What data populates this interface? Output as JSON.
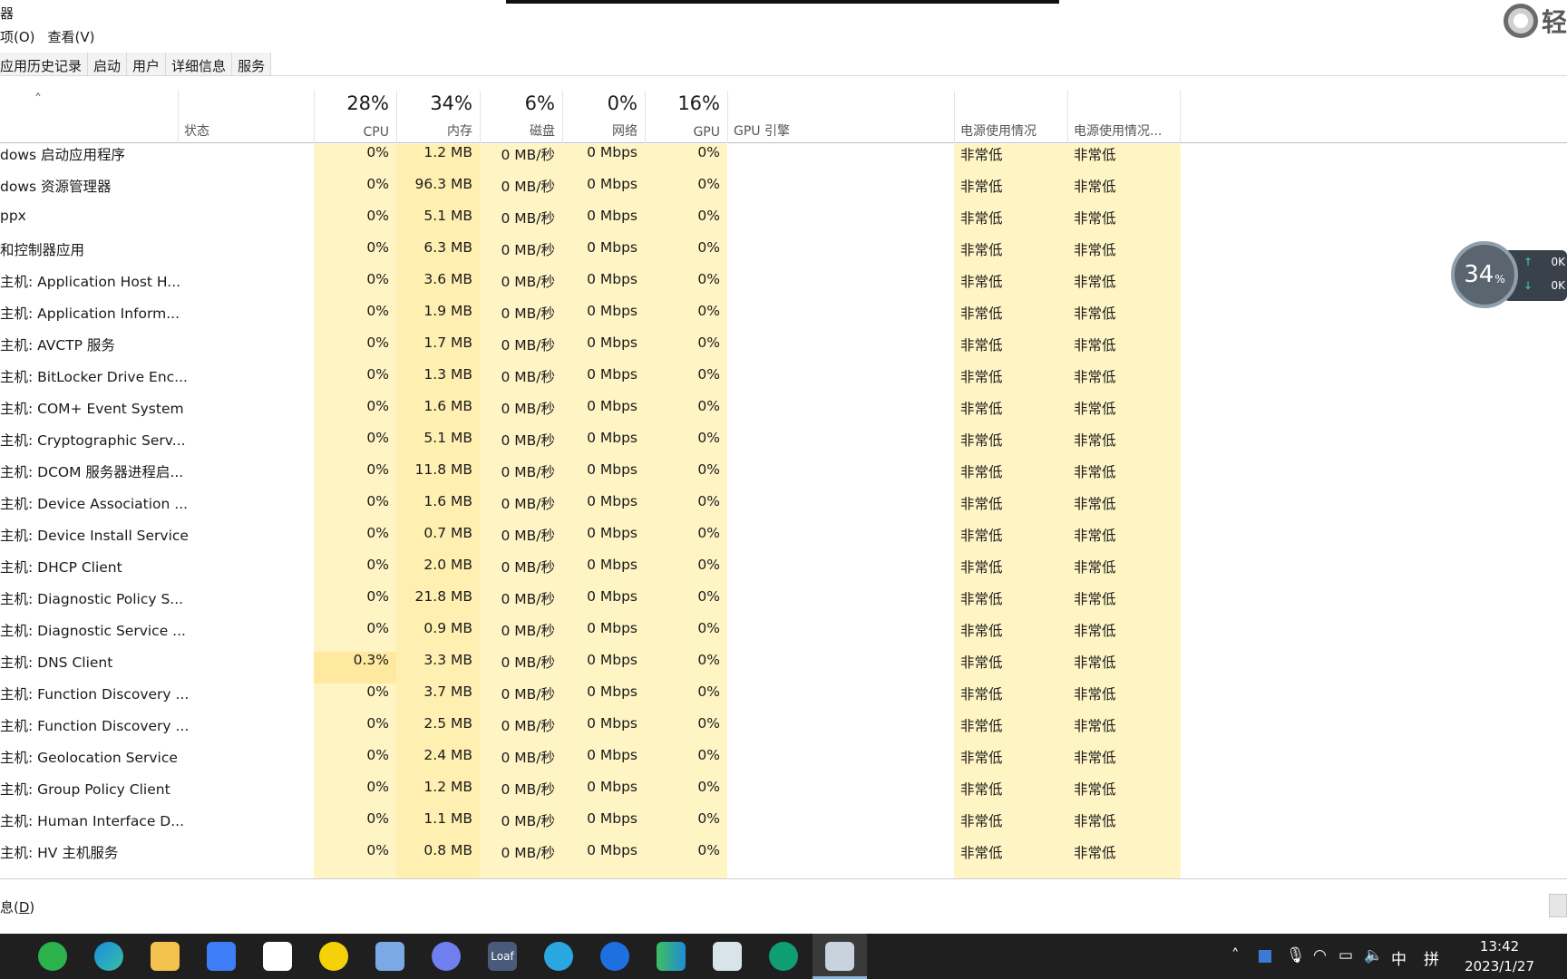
{
  "window": {
    "title_fragment": "器"
  },
  "menu": {
    "options": "项(O)",
    "view": "查看(V)"
  },
  "brand_widget": {
    "text": "轻"
  },
  "tabs": [
    "应用历史记录",
    "启动",
    "用户",
    "详细信息",
    "服务"
  ],
  "header": {
    "status": "状态",
    "cpu_pct": "28%",
    "cpu_label": "CPU",
    "mem_pct": "34%",
    "mem_label": "内存",
    "disk_pct": "6%",
    "disk_label": "磁盘",
    "net_pct": "0%",
    "net_label": "网络",
    "gpu_pct": "16%",
    "gpu_label": "GPU",
    "gpu_engine": "GPU 引擎",
    "power": "电源使用情况",
    "power_trend": "电源使用情况..."
  },
  "rows": [
    {
      "name": "dows 启动应用程序",
      "cpu": "0%",
      "mem": "1.2 MB",
      "disk": "0 MB/秒",
      "net": "0 Mbps",
      "gpu": "0%",
      "p1": "非常低",
      "p2": "非常低"
    },
    {
      "name": "dows 资源管理器",
      "cpu": "0%",
      "mem": "96.3 MB",
      "disk": "0 MB/秒",
      "net": "0 Mbps",
      "gpu": "0%",
      "p1": "非常低",
      "p2": "非常低"
    },
    {
      "name": "ppx",
      "cpu": "0%",
      "mem": "5.1 MB",
      "disk": "0 MB/秒",
      "net": "0 Mbps",
      "gpu": "0%",
      "p1": "非常低",
      "p2": "非常低"
    },
    {
      "name": "和控制器应用",
      "cpu": "0%",
      "mem": "6.3 MB",
      "disk": "0 MB/秒",
      "net": "0 Mbps",
      "gpu": "0%",
      "p1": "非常低",
      "p2": "非常低"
    },
    {
      "name": "主机: Application Host H...",
      "cpu": "0%",
      "mem": "3.6 MB",
      "disk": "0 MB/秒",
      "net": "0 Mbps",
      "gpu": "0%",
      "p1": "非常低",
      "p2": "非常低"
    },
    {
      "name": "主机: Application Inform...",
      "cpu": "0%",
      "mem": "1.9 MB",
      "disk": "0 MB/秒",
      "net": "0 Mbps",
      "gpu": "0%",
      "p1": "非常低",
      "p2": "非常低"
    },
    {
      "name": "主机: AVCTP 服务",
      "cpu": "0%",
      "mem": "1.7 MB",
      "disk": "0 MB/秒",
      "net": "0 Mbps",
      "gpu": "0%",
      "p1": "非常低",
      "p2": "非常低"
    },
    {
      "name": "主机: BitLocker Drive Enc...",
      "cpu": "0%",
      "mem": "1.3 MB",
      "disk": "0 MB/秒",
      "net": "0 Mbps",
      "gpu": "0%",
      "p1": "非常低",
      "p2": "非常低"
    },
    {
      "name": "主机: COM+ Event System",
      "cpu": "0%",
      "mem": "1.6 MB",
      "disk": "0 MB/秒",
      "net": "0 Mbps",
      "gpu": "0%",
      "p1": "非常低",
      "p2": "非常低"
    },
    {
      "name": "主机: Cryptographic Serv...",
      "cpu": "0%",
      "mem": "5.1 MB",
      "disk": "0 MB/秒",
      "net": "0 Mbps",
      "gpu": "0%",
      "p1": "非常低",
      "p2": "非常低"
    },
    {
      "name": "主机: DCOM 服务器进程启...",
      "cpu": "0%",
      "mem": "11.8 MB",
      "disk": "0 MB/秒",
      "net": "0 Mbps",
      "gpu": "0%",
      "p1": "非常低",
      "p2": "非常低"
    },
    {
      "name": "主机: Device Association ...",
      "cpu": "0%",
      "mem": "1.6 MB",
      "disk": "0 MB/秒",
      "net": "0 Mbps",
      "gpu": "0%",
      "p1": "非常低",
      "p2": "非常低"
    },
    {
      "name": "主机: Device Install Service",
      "cpu": "0%",
      "mem": "0.7 MB",
      "disk": "0 MB/秒",
      "net": "0 Mbps",
      "gpu": "0%",
      "p1": "非常低",
      "p2": "非常低"
    },
    {
      "name": "主机: DHCP Client",
      "cpu": "0%",
      "mem": "2.0 MB",
      "disk": "0 MB/秒",
      "net": "0 Mbps",
      "gpu": "0%",
      "p1": "非常低",
      "p2": "非常低"
    },
    {
      "name": "主机: Diagnostic Policy S...",
      "cpu": "0%",
      "mem": "21.8 MB",
      "disk": "0 MB/秒",
      "net": "0 Mbps",
      "gpu": "0%",
      "p1": "非常低",
      "p2": "非常低"
    },
    {
      "name": "主机: Diagnostic Service ...",
      "cpu": "0%",
      "mem": "0.9 MB",
      "disk": "0 MB/秒",
      "net": "0 Mbps",
      "gpu": "0%",
      "p1": "非常低",
      "p2": "非常低"
    },
    {
      "name": "主机: DNS Client",
      "cpu": "0.3%",
      "mem": "3.3 MB",
      "disk": "0 MB/秒",
      "net": "0 Mbps",
      "gpu": "0%",
      "p1": "非常低",
      "p2": "非常低"
    },
    {
      "name": "主机: Function Discovery ...",
      "cpu": "0%",
      "mem": "3.7 MB",
      "disk": "0 MB/秒",
      "net": "0 Mbps",
      "gpu": "0%",
      "p1": "非常低",
      "p2": "非常低"
    },
    {
      "name": "主机: Function Discovery ...",
      "cpu": "0%",
      "mem": "2.5 MB",
      "disk": "0 MB/秒",
      "net": "0 Mbps",
      "gpu": "0%",
      "p1": "非常低",
      "p2": "非常低"
    },
    {
      "name": "主机: Geolocation Service",
      "cpu": "0%",
      "mem": "2.4 MB",
      "disk": "0 MB/秒",
      "net": "0 Mbps",
      "gpu": "0%",
      "p1": "非常低",
      "p2": "非常低"
    },
    {
      "name": "主机: Group Policy Client",
      "cpu": "0%",
      "mem": "1.2 MB",
      "disk": "0 MB/秒",
      "net": "0 Mbps",
      "gpu": "0%",
      "p1": "非常低",
      "p2": "非常低"
    },
    {
      "name": "主机: Human Interface D...",
      "cpu": "0%",
      "mem": "1.1 MB",
      "disk": "0 MB/秒",
      "net": "0 Mbps",
      "gpu": "0%",
      "p1": "非常低",
      "p2": "非常低"
    },
    {
      "name": "主机: HV 主机服务",
      "cpu": "0%",
      "mem": "0.8 MB",
      "disk": "0 MB/秒",
      "net": "0 Mbps",
      "gpu": "0%",
      "p1": "非常低",
      "p2": "非常低"
    }
  ],
  "footer": {
    "details_prefix": "息(",
    "details_key": "D",
    "details_suffix": ")"
  },
  "float_widget": {
    "percent": "34",
    "percent_sign": "%",
    "up": "0K",
    "down": "0K"
  },
  "colors": {
    "cpu_col": "#fff4c4",
    "mem_col": "#ffefb0",
    "other_col": "#fff4c4",
    "cpu_hot": "#ffe9a0"
  },
  "taskbar": {
    "apps": [
      "wechat-icon",
      "edge-icon",
      "file-explorer-icon",
      "feishu-icon",
      "windows-app-icon",
      "app-yellow-icon",
      "control-panel-icon",
      "browser-ring-icon",
      "loaf-icon",
      "bird-icon",
      "k-app-icon",
      "green-app-icon",
      "screen-app-icon",
      "recorder-icon",
      "task-manager-icon"
    ],
    "loaf_label": "Loaf",
    "ime": "中",
    "ime_mode": "拼",
    "time": "13:42",
    "date": "2023/1/27"
  }
}
